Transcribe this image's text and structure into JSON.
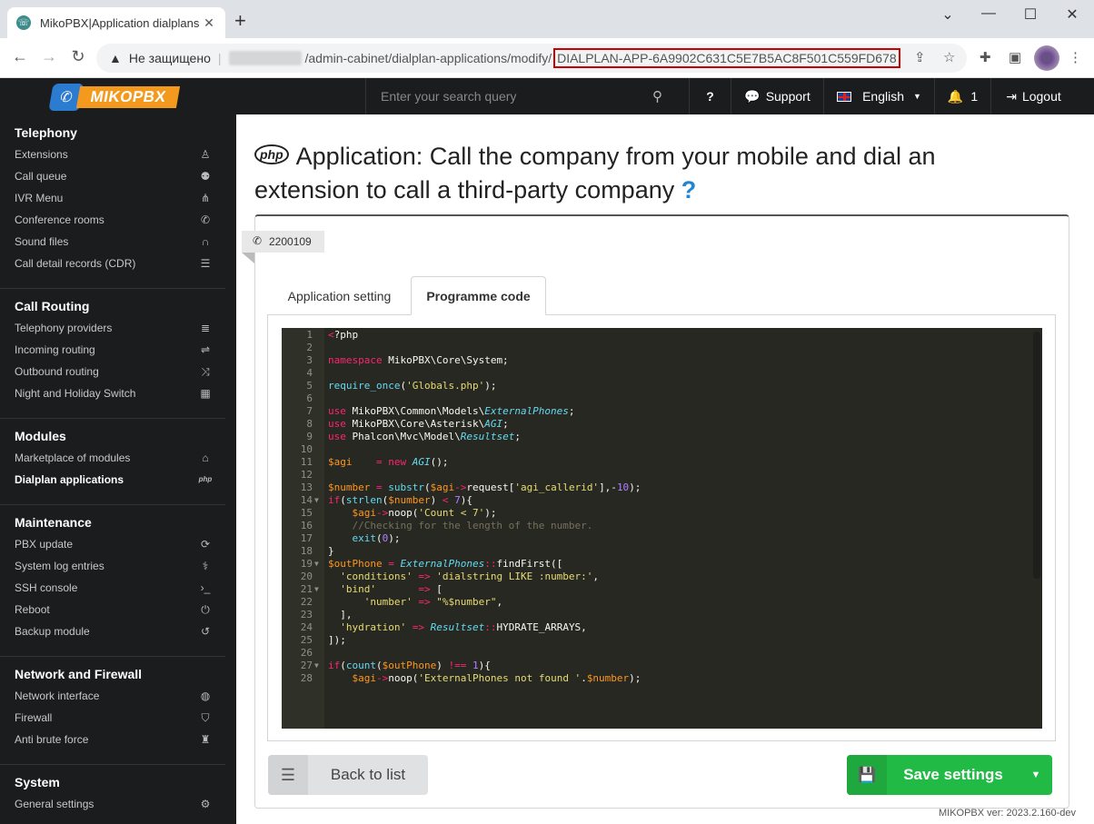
{
  "browser": {
    "tab_title": "MikoPBX|Application dialplans",
    "insecure_label": "Не защищено",
    "url_path": "/admin-cabinet/dialplan-applications/modify/",
    "url_app_id": "DIALPLAN-APP-6A9902C631C5E7B5AC8F501C559FD678"
  },
  "logo": {
    "text": "MIKOPBX"
  },
  "topmenu": {
    "search_placeholder": "Enter your search query",
    "help_label": "?",
    "support_label": "Support",
    "language_label": "English",
    "notifications_count": "1",
    "logout_label": "Logout"
  },
  "sidebar": {
    "sections": [
      {
        "title": "Telephony",
        "items": [
          "Extensions",
          "Call queue",
          "IVR Menu",
          "Conference rooms",
          "Sound files",
          "Call detail records (CDR)"
        ]
      },
      {
        "title": "Call Routing",
        "items": [
          "Telephony providers",
          "Incoming routing",
          "Outbound routing",
          "Night and Holiday Switch"
        ]
      },
      {
        "title": "Modules",
        "items": [
          "Marketplace of modules",
          "Dialplan applications"
        ]
      },
      {
        "title": "Maintenance",
        "items": [
          "PBX update",
          "System log entries",
          "SSH console",
          "Reboot",
          "Backup module"
        ]
      },
      {
        "title": "Network and Firewall",
        "items": [
          "Network interface",
          "Firewall",
          "Anti brute force"
        ]
      },
      {
        "title": "System",
        "items": [
          "General settings"
        ]
      }
    ]
  },
  "page": {
    "title": "Application: Call the company from your mobile and dial an extension to call a third-party company",
    "php_badge": "php",
    "help_mark": "?",
    "extension_number": "2200109",
    "tabs": [
      "Application setting",
      "Programme code"
    ],
    "back_label": "Back to list",
    "save_label": "Save settings",
    "version": "MIKOPBX ver: 2023.2.160-dev"
  },
  "code_lines": [
    "<?php",
    "",
    "namespace MikoPBX\\Core\\System;",
    "",
    "require_once('Globals.php');",
    "",
    "use MikoPBX\\Common\\Models\\ExternalPhones;",
    "use MikoPBX\\Core\\Asterisk\\AGI;",
    "use Phalcon\\Mvc\\Model\\Resultset;",
    "",
    "$agi    = new AGI();",
    "",
    "$number = substr($agi->request['agi_callerid'],-10);",
    "if(strlen($number) < 7){",
    "    $agi->noop('Count < 7');",
    "    //Checking for the length of the number.",
    "    exit(0);",
    "}",
    "$outPhone = ExternalPhones::findFirst([",
    "  'conditions' => 'dialstring LIKE :number:',",
    "  'bind'       => [",
    "      'number' => \"%$number\",",
    "  ],",
    "  'hydration' => Resultset::HYDRATE_ARRAYS,",
    "]);",
    "",
    "if(count($outPhone) !== 1){",
    "    $agi->noop('ExternalPhones not found '.$number);"
  ]
}
